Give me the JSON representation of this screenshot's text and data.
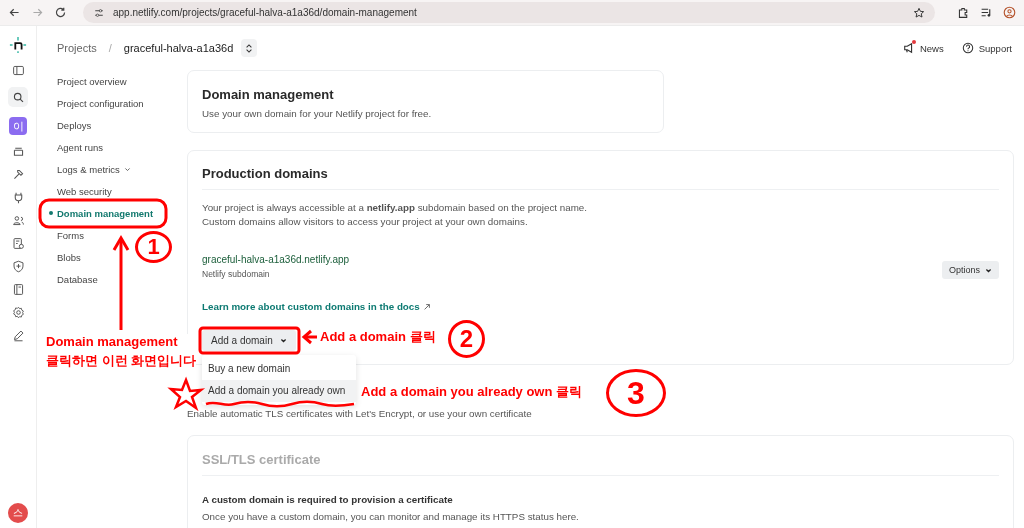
{
  "browser": {
    "url": "app.netlify.com/projects/graceful-halva-a1a36d/domain-management"
  },
  "rail": {
    "team_avatar": "이",
    "user_avatar": "스"
  },
  "header": {
    "breadcrumb": [
      "Projects",
      "graceful-halva-a1a36d"
    ],
    "separator": "/",
    "links": [
      {
        "label": "News",
        "badge": true
      },
      {
        "label": "Support",
        "badge": false
      }
    ]
  },
  "nav": [
    {
      "label": "Project overview",
      "selected": false,
      "kind": "item"
    },
    {
      "label": "Project configuration",
      "selected": false,
      "kind": "item"
    },
    {
      "label": "Deploys",
      "selected": false,
      "kind": "item"
    },
    {
      "label": "Agent runs",
      "selected": false,
      "kind": "item"
    },
    {
      "label": "Logs & metrics",
      "selected": false,
      "kind": "group"
    },
    {
      "label": "Web security",
      "selected": false,
      "kind": "item"
    },
    {
      "label": "Domain management",
      "selected": true,
      "kind": "item"
    },
    {
      "label": "Forms",
      "selected": false,
      "kind": "item"
    },
    {
      "label": "Blobs",
      "selected": false,
      "kind": "item"
    },
    {
      "label": "Database",
      "selected": false,
      "kind": "item"
    }
  ],
  "intro": {
    "title": "Domain management",
    "text": "Use your own domain for your Netlify project for free."
  },
  "production": {
    "title": "Production domains",
    "lines": [
      "Your project is always accessible at a **netlify.app** subdomain based on the project name.",
      "Custom domains allow visitors to access your project at your own domains."
    ],
    "domain": "graceful-halva-a1a36d.netlify.app",
    "domain_caption": "Netlify subdomain",
    "options_button": "Options",
    "docs_link": "Learn more about custom domains in the docs",
    "add_button": "Add a domain",
    "menu": [
      {
        "label": "Buy a new domain",
        "selected": false
      },
      {
        "label": "Add a domain you already own",
        "selected": true
      }
    ]
  },
  "tls_text": "Enable automatic TLS certificates with Let's Encrypt, or use your own certificate",
  "ssl": {
    "title": "SSL/TLS certificate",
    "subtitle": "A custom domain is required to provision a certificate",
    "text": "Once you have a custom domain, you can monitor and manage its HTTPS status here."
  },
  "annotations": {
    "note_1": [
      "Domain management",
      "클릭하면 이런 화면입니다"
    ],
    "note_2": "Add a domain 클릭",
    "note_3": "Add a  domain you already own 클릭",
    "steps": [
      "1",
      "2",
      "3"
    ]
  }
}
